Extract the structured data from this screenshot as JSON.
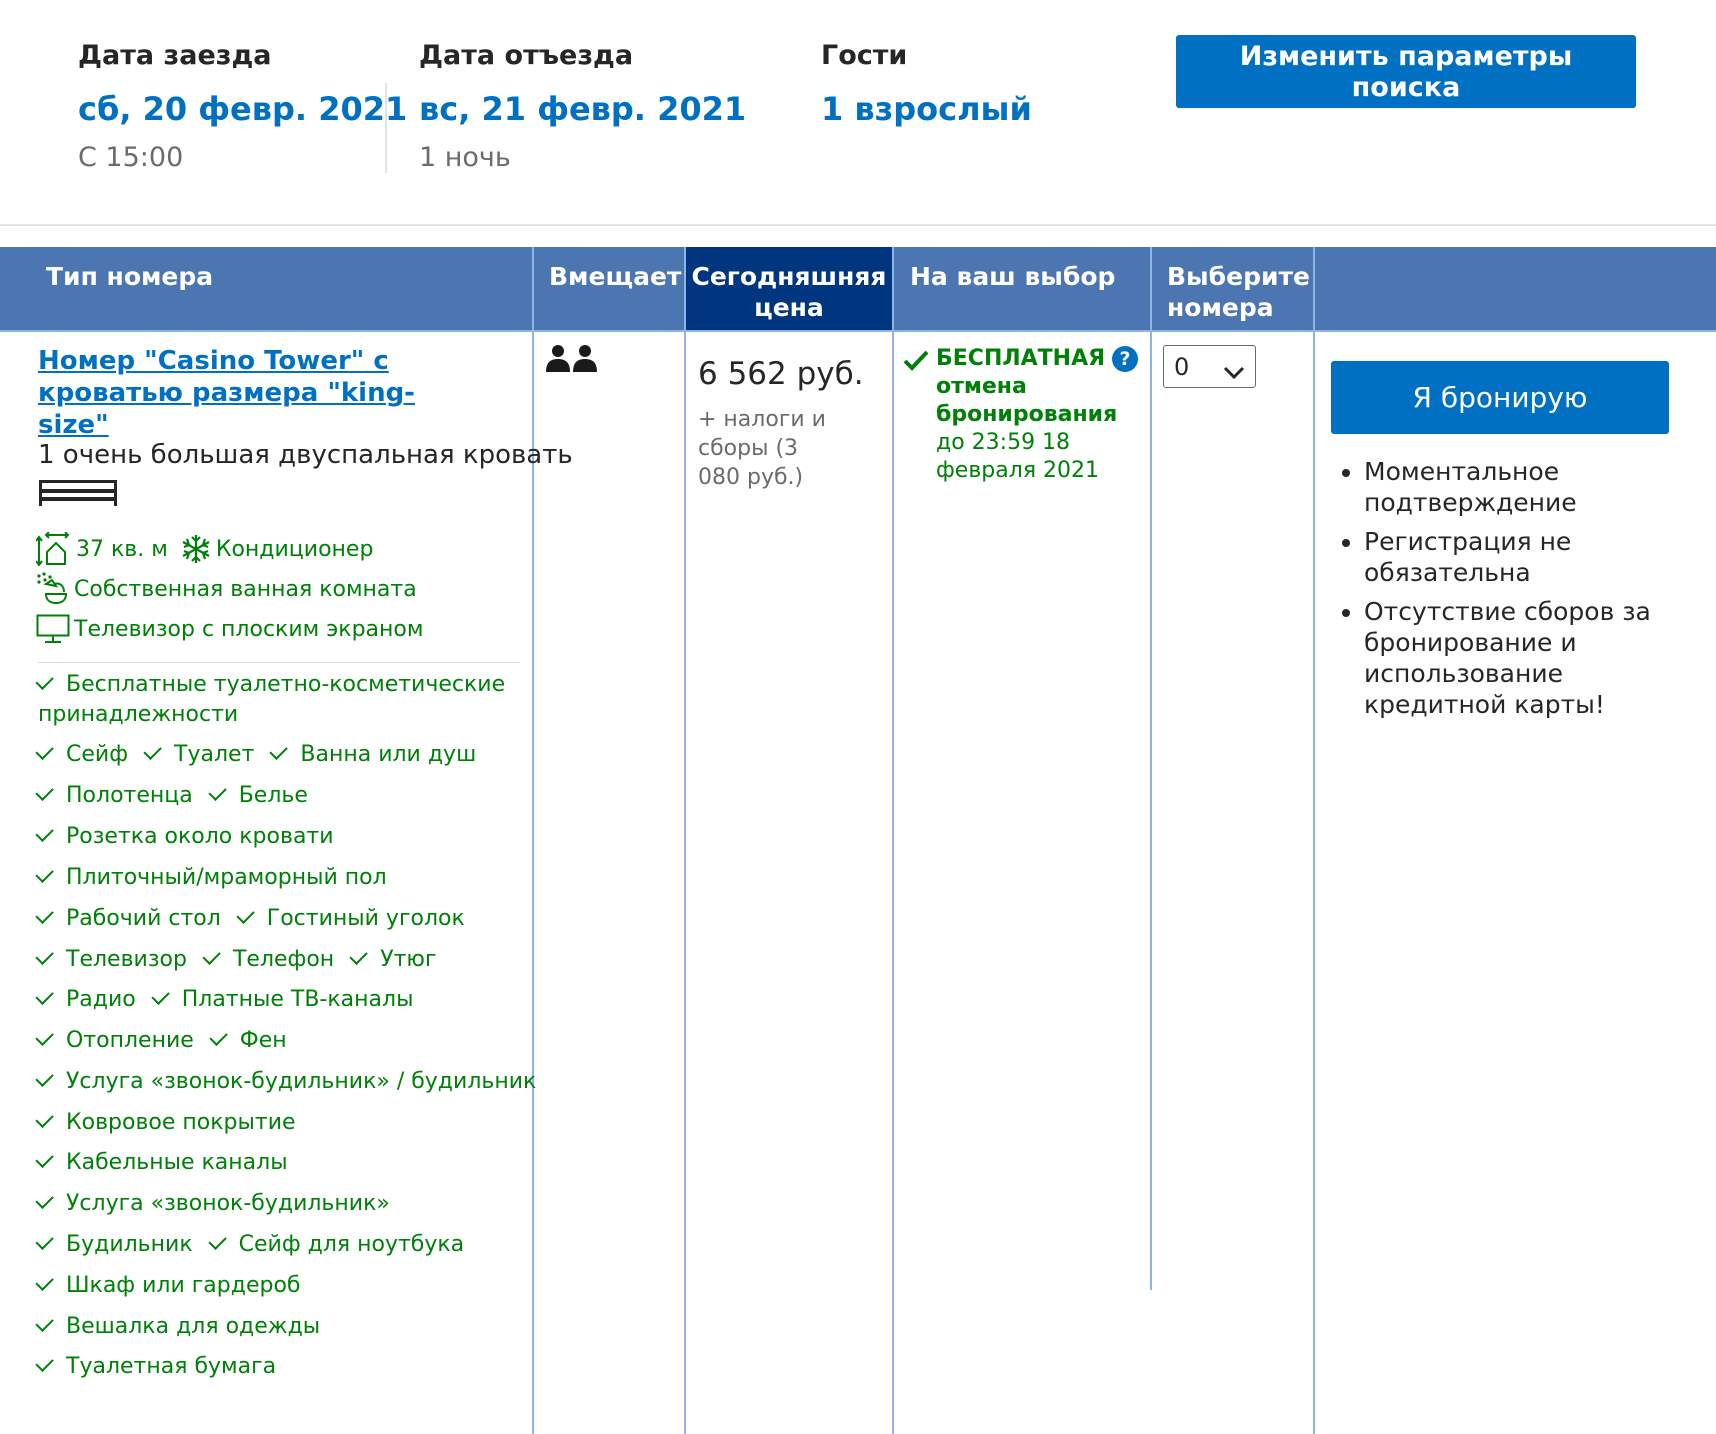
{
  "summary": {
    "checkin_label": "Дата заезда",
    "checkin_date": "сб, 20 февр. 2021",
    "checkin_time": "С 15:00",
    "checkout_label": "Дата отъезда",
    "checkout_date": "вс, 21 февр. 2021",
    "nights": "1 ночь",
    "guests_label": "Гости",
    "guests_value": "1 взрослый",
    "change_button": "Изменить параметры поиска"
  },
  "table": {
    "headers": {
      "room_type": "Тип номера",
      "capacity": "Вмещает",
      "price_line1": "Сегодняшняя",
      "price_line2": "цена",
      "choice": "На ваш выбор",
      "select_line1": "Выберите",
      "select_line2": "номера"
    }
  },
  "room": {
    "title_line1": "Номер \"Casino Tower\" с",
    "title_line2": "кроватью размера \"king-size\"",
    "bed": "1 очень большая двуспальная кровать",
    "facilities": {
      "area": "37 кв. м",
      "ac": "Кондиционер",
      "bathroom": "Собственная ванная комната",
      "tv": "Телевизор с плоским экраном"
    },
    "amenity_rows": [
      [
        "Бесплатные туалетно-косметические принадлежности"
      ],
      [
        "Сейф",
        "Туалет",
        "Ванна или душ"
      ],
      [
        "Полотенца",
        "Белье"
      ],
      [
        "Розетка около кровати"
      ],
      [
        "Плиточный/мраморный пол"
      ],
      [
        "Рабочий стол",
        "Гостиный уголок"
      ],
      [
        "Телевизор",
        "Телефон",
        "Утюг"
      ],
      [
        "Радио",
        "Платные ТВ-каналы"
      ],
      [
        "Отопление",
        "Фен"
      ],
      [
        "Услуга «звонок-будильник» / будильник"
      ],
      [
        "Ковровое покрытие"
      ],
      [
        "Кабельные каналы"
      ],
      [
        "Услуга «звонок-будильник»"
      ],
      [
        "Будильник",
        "Сейф для ноутбука"
      ],
      [
        "Шкаф или гардероб"
      ],
      [
        "Вешалка для одежды"
      ],
      [
        "Туалетная бумага"
      ]
    ]
  },
  "price": {
    "amount": "6 562 руб.",
    "taxes_line1": "+ налоги и",
    "taxes_line2": "сборы (3",
    "taxes_line3": "080 руб.)"
  },
  "cancellation": {
    "line1": "БЕСПЛАТНАЯ",
    "line2": "отмена",
    "line3": "бронирования",
    "until_line1": "до 23:59 18",
    "until_line2": "февраля 2021",
    "help_glyph": "?"
  },
  "quantity": {
    "selected": "0"
  },
  "booking": {
    "button": "Я бронирую",
    "benefits": [
      "Моментальное подтверждение",
      "Регистрация не обязательна",
      "Отсутствие сборов за бронирование и использование кредитной карты!"
    ]
  },
  "colors": {
    "accent": "#0071c2",
    "header": "#4c76b2",
    "header_dark": "#003580",
    "green": "#008009"
  },
  "icons": {
    "persons": "two-persons-icon",
    "bed": "bed-icon",
    "area": "room-size-icon",
    "ac": "snowflake-icon",
    "bathroom": "shower-icon",
    "tv": "monitor-icon",
    "check": "checkmark-icon",
    "help": "question-circle-icon",
    "chevron": "chevron-down-icon"
  }
}
